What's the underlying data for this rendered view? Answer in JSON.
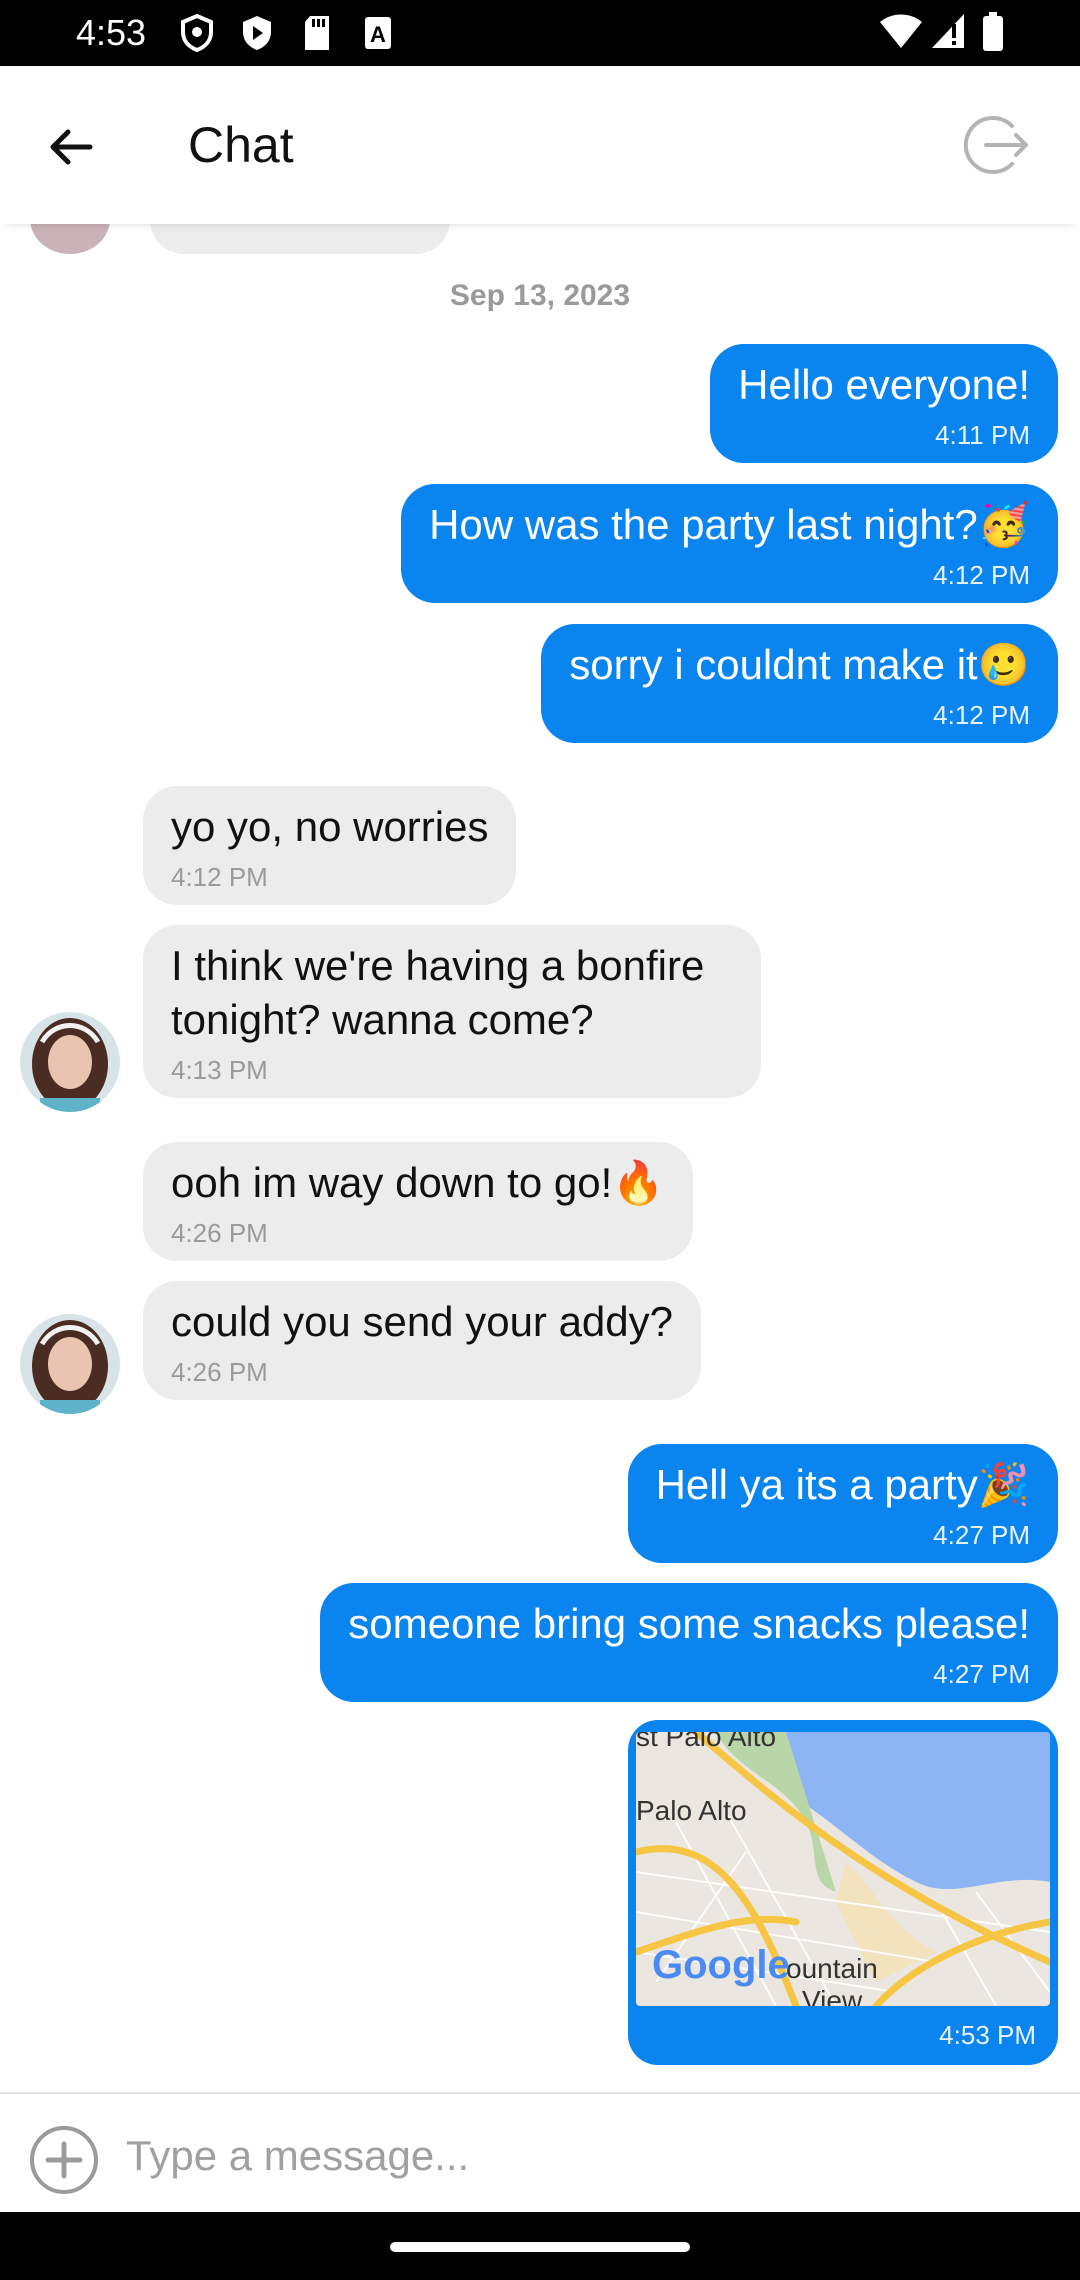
{
  "status_bar": {
    "time": "4:53",
    "icons": [
      "shield-icon",
      "play-icon",
      "sd-card-icon",
      "font-a-icon"
    ],
    "right_icons": [
      "wifi-icon",
      "signal-icon",
      "battery-icon"
    ]
  },
  "app_bar": {
    "title": "Chat",
    "back_icon": "arrow-back-icon",
    "leave_icon": "logout-icon"
  },
  "chat": {
    "date": "Sep 13, 2023",
    "messages": [
      {
        "dir": "out",
        "text": "Hello everyone!",
        "time": "4:11 PM"
      },
      {
        "dir": "out",
        "text": "How was the party last night?🥳",
        "time": "4:12 PM"
      },
      {
        "dir": "out",
        "text": "sorry i couldnt make it🥲",
        "time": "4:12 PM"
      },
      {
        "dir": "in",
        "text": "yo yo, no worries",
        "time": "4:12 PM"
      },
      {
        "dir": "in",
        "text": "I think we're having a bonfire tonight? wanna come?",
        "time": "4:13 PM"
      },
      {
        "dir": "in",
        "text": "ooh im way down to go!🔥",
        "time": "4:26 PM"
      },
      {
        "dir": "in",
        "text": "could you send your addy?",
        "time": "4:26 PM"
      },
      {
        "dir": "out",
        "text": "Hell ya its a party🎉",
        "time": "4:27 PM"
      },
      {
        "dir": "out",
        "text": "someone bring some snacks please!",
        "time": "4:27 PM"
      }
    ],
    "map_message": {
      "labels": [
        "st Palo Alto",
        "Palo Alto",
        "ountain",
        "View",
        "Google"
      ],
      "time": "4:53 PM"
    }
  },
  "composer": {
    "placeholder": "Type a message...",
    "value": "",
    "add_icon": "add-circle-icon"
  },
  "colors": {
    "outgoing_bubble": "#0a84ee",
    "incoming_bubble": "#ececec",
    "secondary_text": "#9a9a9a"
  }
}
